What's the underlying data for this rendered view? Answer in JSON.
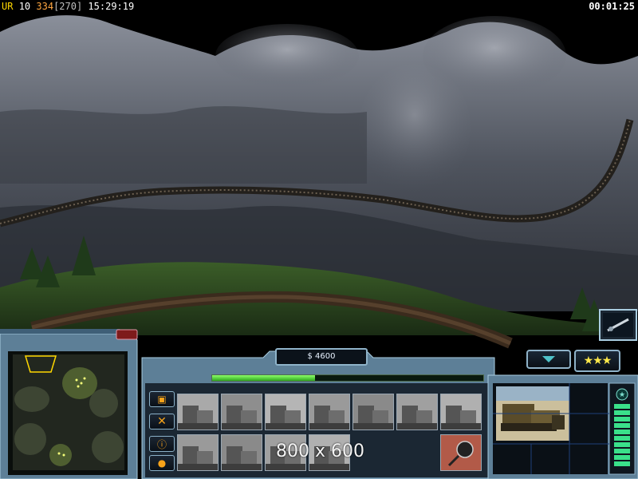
{
  "debug_overlay": {
    "prefix": "UR",
    "fps": "10",
    "frame": "334",
    "frame_bracket": "[270]",
    "clock": "15:29:19"
  },
  "game_timer": "00:01:25",
  "hud": {
    "money": "$ 4600",
    "power_level": 0.38,
    "resolution_text": "800 x 600",
    "stars": "★★★"
  },
  "command_bar": {
    "row1": [
      "command-center",
      "barracks",
      "supply-center",
      "airfield",
      "artillery",
      "war-factory",
      "strategy-center"
    ],
    "row2": [
      "power-plant",
      "naval-yard",
      "fire-base",
      "patriot-battery"
    ],
    "special": "cash-bounty"
  },
  "side_buttons": [
    "options-icon",
    "build-icon",
    "alert-icon",
    "chat-icon"
  ],
  "selection": {
    "unit": "bulldozer-portrait"
  },
  "colors": {
    "panel_blue": "#5d7f97",
    "panel_dark": "#1d2b39",
    "power_green": "#5ee03a",
    "text_yellow": "#ffd700"
  }
}
